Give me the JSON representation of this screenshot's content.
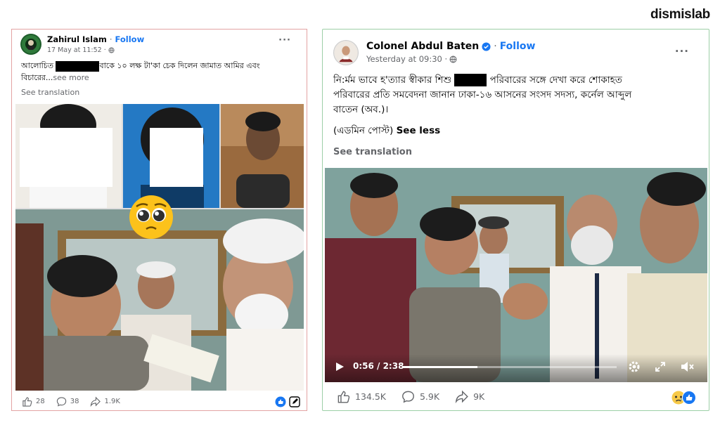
{
  "brand": "dismislab",
  "left_post": {
    "author": "Zahirul Islam",
    "follow": "Follow",
    "timestamp": "17 May at 11:52 ·",
    "text_line1_before": "আলোচিত",
    "text_line1_after": "বাকে ১০ লক্ষ টা'কা চেক দিলেন জামাত আমির এবং",
    "text_line2": "বিচারের...",
    "see_more": "see more",
    "see_translation": "See translation",
    "more_icon": "···",
    "emoji_icon": "pleading-face-emoji",
    "stats": {
      "likes": "28",
      "comments": "38",
      "shares": "1.9K"
    }
  },
  "right_post": {
    "author": "Colonel Abdul Baten",
    "follow": "Follow",
    "timestamp": "Yesterday at 09:30 ·",
    "text_line1_before": "নি:র্মম ভাবে হ'ত্যার স্বীকার শিশু",
    "text_line1_after": "পরিবারের সঙ্গে দেখা করে শোকাহত",
    "text_line2": "পরিবারের প্রতি সমবেদনা জানান ঢাকা-১৬ আসনের সংসদ সদস্য, কর্নেল আব্দুল",
    "text_line3": "বাতেন (অব.)।",
    "admin_post": "(এডমিন পোস্ট)",
    "see_less": "See less",
    "see_translation": "See translation",
    "more_icon": "···",
    "video": {
      "time": "0:56 / 2:38",
      "progress": 0.35
    },
    "stats": {
      "likes": "134.5K",
      "comments": "5.9K",
      "shares": "9K"
    }
  },
  "colors": {
    "link": "#1877f2",
    "muted": "#65676b",
    "left_border": "#e3a3a3",
    "right_border": "#9ccfa6"
  }
}
